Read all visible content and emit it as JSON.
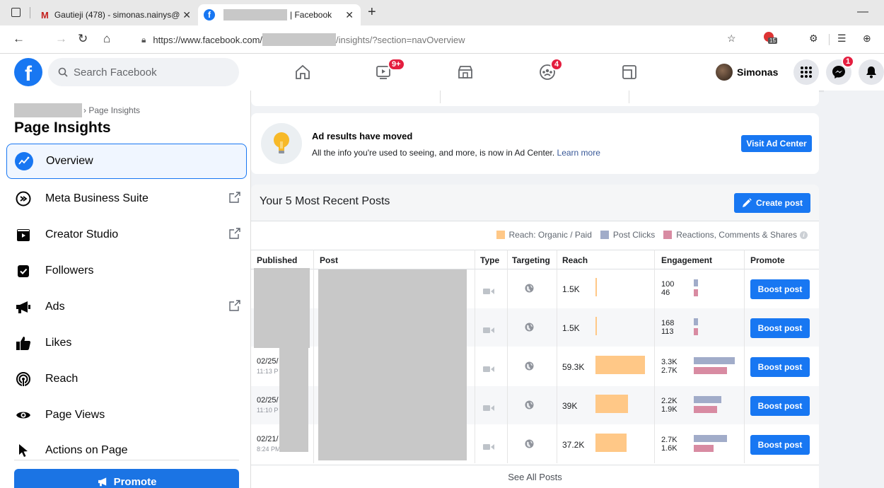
{
  "browser": {
    "tab1_title": "Gautieji (478) - simonas.nainys@",
    "tab2_title": "| Facebook",
    "tab1_icon": "M",
    "url_prefix": "https://www.facebook.com/",
    "url_suffix": "/insights/?section=navOverview",
    "ext_badge": "15"
  },
  "header": {
    "search_placeholder": "Search Facebook",
    "watch_badge": "9+",
    "groups_badge": "4",
    "profile_name": "Simonas",
    "messenger_badge": "1"
  },
  "sidebar": {
    "breadcrumb": "› Page Insights",
    "title": "Page Insights",
    "items": [
      {
        "label": "Overview"
      },
      {
        "label": "Meta Business Suite"
      },
      {
        "label": "Creator Studio"
      },
      {
        "label": "Followers"
      },
      {
        "label": "Ads"
      },
      {
        "label": "Likes"
      },
      {
        "label": "Reach"
      },
      {
        "label": "Page Views"
      },
      {
        "label": "Actions on Page"
      }
    ],
    "promote_label": "Promote"
  },
  "ad_notice": {
    "title": "Ad results have moved",
    "text": "All the info you're used to seeing, and more, is now in Ad Center.",
    "link": "Learn more",
    "button": "Visit Ad Center"
  },
  "posts": {
    "title": "Your 5 Most Recent Posts",
    "create_label": "Create post",
    "legend": [
      "Reach: Organic / Paid",
      "Post Clicks",
      "Reactions, Comments & Shares"
    ],
    "columns": [
      "Published",
      "Post",
      "Type",
      "Targeting",
      "Reach",
      "Engagement",
      "Promote"
    ],
    "rows": [
      {
        "date": "",
        "time": "",
        "reach": "1.5K",
        "reach_value": 1500,
        "clicks": "100",
        "clicks_value": 100,
        "reactions": "46",
        "reactions_value": 46
      },
      {
        "date": "",
        "time": "",
        "reach": "1.5K",
        "reach_value": 1500,
        "clicks": "168",
        "clicks_value": 168,
        "reactions": "113",
        "reactions_value": 113
      },
      {
        "date": "02/25/",
        "time": "11:13 P",
        "reach": "59.3K",
        "reach_value": 59300,
        "clicks": "3.3K",
        "clicks_value": 3300,
        "reactions": "2.7K",
        "reactions_value": 2700
      },
      {
        "date": "02/25/",
        "time": "11:10 P",
        "reach": "39K",
        "reach_value": 39000,
        "clicks": "2.2K",
        "clicks_value": 2200,
        "reactions": "1.9K",
        "reactions_value": 1900
      },
      {
        "date": "02/21/",
        "time": "8:24 PM",
        "reach": "37.2K",
        "reach_value": 37200,
        "clicks": "2.7K",
        "clicks_value": 2700,
        "reactions": "1.6K",
        "reactions_value": 1600
      }
    ],
    "boost_label": "Boost post",
    "see_all": "See All Posts"
  },
  "colors": {
    "accent": "#1877f2",
    "reach_bar": "#ffc887",
    "clicks_bar": "#a1acc9",
    "reactions_bar": "#d88ba2"
  }
}
